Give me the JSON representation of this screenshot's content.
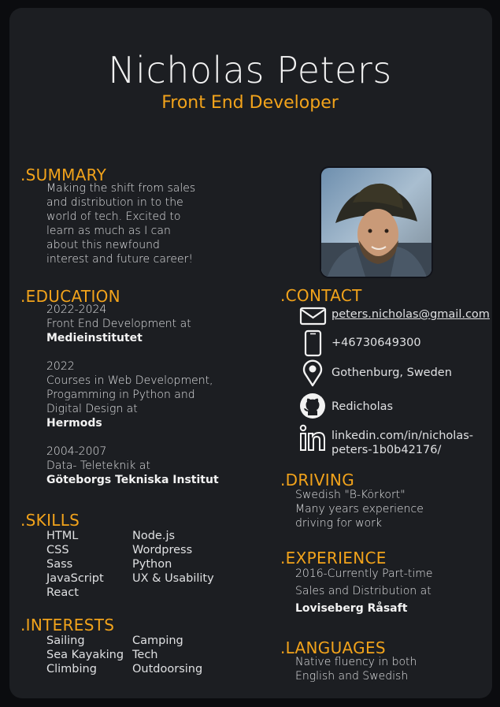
{
  "header": {
    "name": "Nicholas Peters",
    "title": "Front End Developer"
  },
  "summary": {
    "heading": ".SUMMARY",
    "lines": [
      "Making the shift from sales",
      "and distribution in to the",
      "world of tech. Excited to",
      "learn as much as I can",
      "about this newfound",
      "interest and future career!"
    ]
  },
  "education": {
    "heading": ".EDUCATION",
    "entries": [
      {
        "years": "2022-2024",
        "lines": [
          "Front End Development at"
        ],
        "school": "Medieinstitutet"
      },
      {
        "years": "2022",
        "lines": [
          "Courses in Web Development,",
          "Progamming in Python and",
          "Digital Design at"
        ],
        "school": "Hermods"
      },
      {
        "years": "2004-2007",
        "lines": [
          "Data- Teleteknik at"
        ],
        "school": "Göteborgs Tekniska Institut"
      }
    ]
  },
  "skills": {
    "heading": ".SKILLS",
    "col1": [
      "HTML",
      "CSS",
      "Sass",
      "JavaScript",
      "React"
    ],
    "col2": [
      "Node.js",
      "Wordpress",
      "Python",
      "UX & Usability"
    ]
  },
  "interests": {
    "heading": ".INTERESTS",
    "col1": [
      "Sailing",
      "Sea Kayaking",
      "Climbing"
    ],
    "col2": [
      "Camping",
      "Tech",
      "Outdoorsing"
    ]
  },
  "contact": {
    "heading": ".CONTACT",
    "email": "peters.nicholas@gmail.com",
    "phone": "+46730649300",
    "location": "Gothenburg, Sweden",
    "github": "Redicholas",
    "linkedin_line1": "linkedin.com/in/nicholas-",
    "linkedin_line2": "peters-1b0b42176/",
    "icons": {
      "email": "envelope-icon",
      "phone": "phone-icon",
      "location": "map-pin-icon",
      "github": "github-icon",
      "linkedin": "linkedin-icon"
    }
  },
  "driving": {
    "heading": ".DRIVING",
    "lines": [
      "Swedish \"B-Körkort\"",
      "Many years experience",
      "driving for work"
    ]
  },
  "experience": {
    "heading": ".EXPERIENCE",
    "line1": "2016-Currently Part-time",
    "line2": "Sales and Distribution at",
    "company": "Loviseberg Råsaft"
  },
  "languages": {
    "heading": ".LANGUAGES",
    "lines": [
      "Native fluency in both",
      "English and Swedish"
    ]
  },
  "colors": {
    "accent": "#f2a31b",
    "card": "#1c1e22",
    "page": "#0b0c0f",
    "text": "#dfe0e2"
  }
}
